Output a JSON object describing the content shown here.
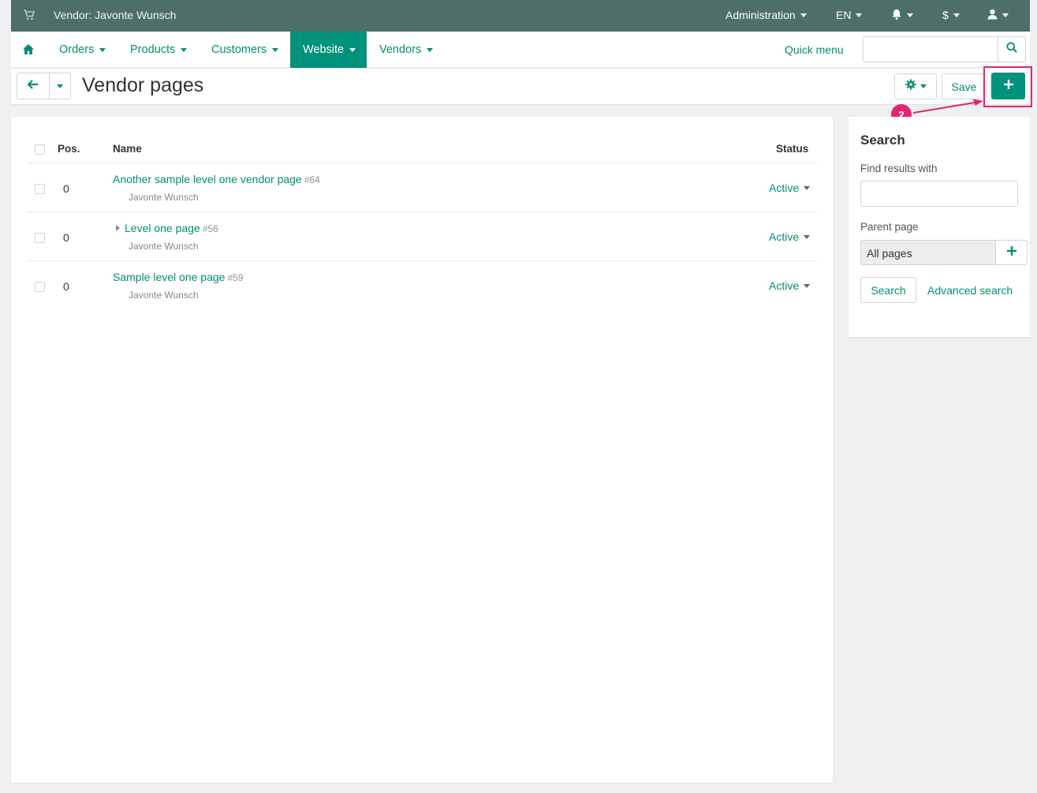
{
  "topbar": {
    "vendor_label": "Vendor: Javonte Wunsch",
    "administration": "Administration",
    "language": "EN",
    "currency": "$"
  },
  "nav": {
    "items": [
      {
        "label": "Orders"
      },
      {
        "label": "Products"
      },
      {
        "label": "Customers"
      },
      {
        "label": "Website",
        "active": true
      },
      {
        "label": "Vendors"
      }
    ],
    "quick_menu": "Quick menu",
    "search_value": ""
  },
  "toolbar": {
    "title": "Vendor pages",
    "save_label": "Save",
    "annotation_number": "2"
  },
  "table": {
    "headers": {
      "pos": "Pos.",
      "name": "Name",
      "status": "Status"
    },
    "rows": [
      {
        "pos": "0",
        "name": "Another sample level one vendor page",
        "id": "#64",
        "owner": "Javonte Wunsch",
        "status": "Active",
        "has_children": false
      },
      {
        "pos": "0",
        "name": "Level one page",
        "id": "#56",
        "owner": "Javonte Wunsch",
        "status": "Active",
        "has_children": true
      },
      {
        "pos": "0",
        "name": "Sample level one page",
        "id": "#59",
        "owner": "Javonte Wunsch",
        "status": "Active",
        "has_children": false
      }
    ]
  },
  "sidebar": {
    "title": "Search",
    "find_label": "Find results with",
    "find_value": "",
    "parent_label": "Parent page",
    "parent_value": "All pages",
    "search_button": "Search",
    "advanced_link": "Advanced search"
  },
  "colors": {
    "topbar": "#4d6f67",
    "accent": "#00927a",
    "link": "#008f72",
    "annotation": "#e5246f"
  },
  "icons": [
    "cart-icon",
    "home-icon",
    "bell-icon",
    "user-icon",
    "search-icon",
    "back-arrow-icon",
    "gear-icon",
    "plus-icon"
  ]
}
